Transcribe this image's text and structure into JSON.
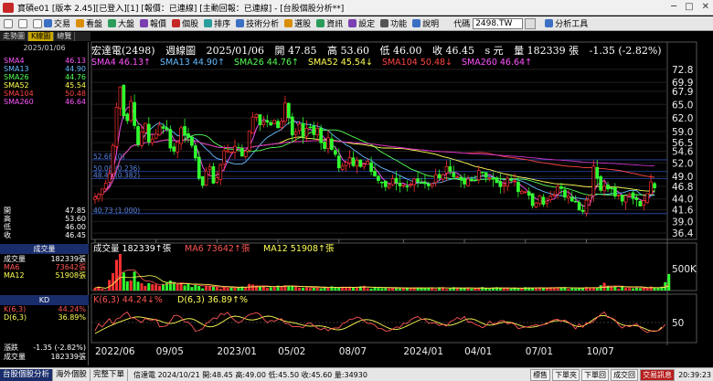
{
  "window": {
    "title": "寶碩e01 [版本 2.45][已登入][1] [報價：已連線] [主動回報：已連線] - [台股個股分析**]"
  },
  "toolbar": {
    "items": [
      "交易",
      "看盤",
      "大盤",
      "報價",
      "個股",
      "排序",
      "技術分析",
      "選股",
      "資訊",
      "設定",
      "功能",
      "說明"
    ],
    "code_label": "代碼",
    "code_value": "2498.TW",
    "analysis_tool": "分析工具"
  },
  "tabs": [
    "走勢圖",
    "K線圖",
    "總覽"
  ],
  "left_panel": {
    "date": "2025/01/06",
    "ma_rows": [
      {
        "k": "SMA4",
        "v": "46.13",
        "color": "#ff55ff"
      },
      {
        "k": "SMA13",
        "v": "44.90",
        "color": "#66bbff"
      },
      {
        "k": "SMA26",
        "v": "44.76",
        "color": "#55ff55"
      },
      {
        "k": "SMA52",
        "v": "45.54",
        "color": "#ffff55"
      },
      {
        "k": "SMA104",
        "v": "50.48",
        "color": "#ff4444"
      },
      {
        "k": "SMA260",
        "v": "46.64",
        "color": "#ff55ff"
      }
    ],
    "ohlc_rows": [
      {
        "k": "開",
        "v": "47.85"
      },
      {
        "k": "高",
        "v": "53.60"
      },
      {
        "k": "低",
        "v": "46.00"
      },
      {
        "k": "收",
        "v": "46.45"
      }
    ],
    "vol_head": "成交量",
    "vol_rows": [
      {
        "k": "成交量",
        "v": "182339張",
        "color": "#ffffff"
      },
      {
        "k": "MA6",
        "v": "73642張",
        "color": "#ff5555"
      },
      {
        "k": "MA12",
        "v": "51908張",
        "color": "#ffff55"
      }
    ],
    "kd_head": "KD",
    "kd_rows": [
      {
        "k": "K(6,3)",
        "v": "44.24%",
        "color": "#ff5555"
      },
      {
        "k": "D(6,3)",
        "v": "36.89%",
        "color": "#ffff55"
      }
    ],
    "change_rows": [
      {
        "k": "漲跌",
        "v": "-1.35 (-2.82%)"
      },
      {
        "k": "成交量",
        "v": "182339張"
      }
    ]
  },
  "chart_header": {
    "name": "宏達電(2498)",
    "period": "週線圖",
    "date": "2025/01/06",
    "open": "開 47.85",
    "high": "高 53.60",
    "low": "低 46.00",
    "close": "收 46.45",
    "unit": "s 元",
    "volume": "量 182339 張",
    "change": "-1.35 (-2.82%)"
  },
  "ma_legend": [
    {
      "text": "SMA4 46.13↑",
      "color": "#ff55ff"
    },
    {
      "text": "SMA13 44.90↑",
      "color": "#66bbff"
    },
    {
      "text": "SMA26 44.76↑",
      "color": "#55ff55"
    },
    {
      "text": "SMA52 45.54↓",
      "color": "#ffff55"
    },
    {
      "text": "SMA104 50.48↓",
      "color": "#ff4444"
    },
    {
      "text": "SMA260 46.64↑",
      "color": "#ff55ff"
    }
  ],
  "volume_legend": [
    {
      "text": "成交量 182339↑張",
      "color": "#ffffff"
    },
    {
      "text": "MA6 73642↑張",
      "color": "#ff5555"
    },
    {
      "text": "MA12 51908↑張",
      "color": "#ffff55"
    }
  ],
  "kd_legend": [
    {
      "text": "K(6,3) 44.24↓%",
      "color": "#ff5555"
    },
    {
      "text": "D(6,3) 36.89↑%",
      "color": "#ffff55"
    }
  ],
  "fib_labels": [
    "52.68 (0)",
    "50.08 (0.236)",
    "48.49 (0.382)",
    "40.73 (1.000)"
  ],
  "chart_data": {
    "type": "candlestick",
    "price_axis": [
      "72.8",
      "69.9",
      "67.9",
      "65.0",
      "62.0",
      "59.0",
      "56.5",
      "54.6",
      "52.0",
      "49.0",
      "46.8",
      "44.0",
      "41.6",
      "39.0",
      "36.4"
    ],
    "price_range": [
      35.0,
      74.0
    ],
    "x_labels": [
      "2022/06",
      "09/05",
      "2023/01",
      "05/02",
      "08/07",
      "2024/01",
      "04/01",
      "07/01",
      "10/07"
    ],
    "volume_axis": [
      "500K"
    ],
    "kd_axis": [
      "50"
    ],
    "fib_levels": [
      52.68,
      50.08,
      48.49,
      40.73
    ],
    "close_series": [
      44.4,
      45,
      46.2,
      47.5,
      49.6,
      55.9,
      64.4,
      68.9,
      62.5,
      61.4,
      65.7,
      60.3,
      56.1,
      58.9,
      60.8,
      56.7,
      57.3,
      58.4,
      60.4,
      59.7,
      59.5,
      55.3,
      54.6,
      56.6,
      59.8,
      58.2,
      57.7,
      55.9,
      53.1,
      48.6,
      47,
      50.2,
      51.1,
      47.5,
      48.7,
      51.6,
      54.7,
      54.7,
      54.4,
      55.7,
      55.4,
      53.5,
      54.6,
      59,
      62.2,
      62.8,
      60.5,
      61.1,
      61.1,
      60.4,
      61.5,
      59.8,
      61.2,
      65.3,
      62.1,
      58.2,
      58.9,
      60.6,
      57.9,
      59.7,
      59.8,
      58.3,
      59.7,
      56.5,
      55.2,
      57.6,
      55,
      53.9,
      50.9,
      51.3,
      52.1,
      53.2,
      51.4,
      52.6,
      51.2,
      51.7,
      52.4,
      50.1,
      49.1,
      48.1,
      47.7,
      46.7,
      47,
      48.5,
      47.6,
      46.9,
      47.1,
      46.7,
      47.3,
      48.4,
      47.8,
      47.6,
      47.4,
      46.9,
      47.4,
      49.4,
      48.7,
      49.4,
      51.2,
      50.1,
      48.9,
      48.9,
      48.3,
      47.3,
      48.4,
      48.2,
      48.2,
      50.3,
      49.9,
      48.8,
      48.7,
      48.4,
      47.6,
      46.7,
      47.2,
      48.6,
      48.1,
      48,
      45.6,
      45.7,
      45.6,
      44.8,
      42.5,
      43.1,
      44.7,
      42.8,
      43.5,
      44.6,
      44.9,
      46.8,
      46.3,
      44.4,
      44.6,
      43.5,
      43.3,
      41.5,
      41.2,
      43.7,
      44.8,
      51.3,
      48.6,
      45.9,
      46.8,
      46.2,
      46.4,
      44.6,
      44.9,
      43.5,
      44.6,
      45,
      44.1,
      43.8,
      42.4,
      43.6,
      45.2,
      47.8,
      46.45
    ],
    "volume_series": [
      29,
      44,
      20,
      7,
      116,
      192,
      338,
      402,
      199,
      101,
      110,
      208,
      97,
      80,
      51,
      80,
      69,
      68,
      52,
      72,
      85,
      109,
      88,
      71,
      79,
      56,
      75,
      39,
      67,
      51,
      24,
      53,
      49,
      43,
      39,
      20,
      36,
      29,
      42,
      35,
      31,
      44,
      30,
      72,
      66,
      54,
      44,
      41,
      29,
      36,
      44,
      54,
      45,
      58,
      54,
      53,
      42,
      32,
      31,
      36,
      28,
      33,
      36,
      23,
      35,
      32,
      46,
      40,
      30,
      41,
      34,
      36,
      31,
      41,
      47,
      52,
      25,
      21,
      40,
      32,
      26,
      28,
      20,
      26,
      26,
      29,
      34,
      34,
      26,
      33,
      29,
      29,
      24,
      35,
      32,
      15,
      36,
      37,
      15,
      21,
      37,
      33,
      26,
      28,
      34,
      20,
      22,
      25,
      38,
      26,
      18,
      33,
      37,
      27,
      30,
      30,
      20,
      27,
      20,
      25,
      37,
      34,
      27,
      34,
      33,
      23,
      29,
      37,
      34,
      36,
      32,
      31,
      18,
      27,
      23,
      32,
      33,
      38,
      31,
      36,
      26,
      58,
      86,
      53,
      39,
      43,
      21,
      48,
      29,
      27,
      23,
      38,
      25,
      28,
      26,
      44,
      33,
      34,
      42,
      92,
      182
    ],
    "k_series": [
      26.4,
      46.5,
      37,
      49.8,
      61.1,
      45.5,
      60.6,
      63.3,
      74.5,
      80.1,
      63.1,
      63.3,
      55.7,
      50.3,
      62,
      57.9,
      56.8,
      59.7,
      37.7,
      38.7,
      40.6,
      53.7,
      69.9,
      70.9,
      65.1,
      52.2,
      51.2,
      40.8,
      25.1,
      27.6,
      31.8,
      47.4,
      53.5,
      63.4,
      60.8,
      76,
      72.7,
      79.1,
      65.4,
      55.5,
      48.9,
      54.5,
      65.7,
      72.7,
      75.6,
      78.5,
      73.8,
      60.4,
      49.3,
      56.1,
      54,
      58.6,
      60.8,
      47.1,
      46.7,
      37.6,
      38.4,
      38.4,
      34.4,
      46.6,
      48.6,
      41.3,
      33.6,
      29.2,
      34.7,
      26.1,
      33.2,
      34.3,
      34.4,
      47,
      50.9,
      59.6,
      60,
      65.7,
      62.6,
      54.6,
      47.5,
      47.3,
      42.5,
      32.3,
      32.4,
      25.2,
      26.4,
      31.1,
      37.4,
      35.8,
      48,
      46.9,
      57.7,
      63.8,
      67.4,
      59.8,
      58.3,
      47.5,
      49,
      48.5,
      41.4,
      44.6,
      39.5,
      52.7,
      56.7,
      64.6,
      58.9,
      67.3,
      51.3,
      51.4,
      44.7,
      41.1,
      35,
      40.2,
      53.9,
      45.9,
      47.6,
      54.8,
      55.6,
      45.8,
      48.9,
      44.7,
      32.3,
      35,
      37.3,
      37.9,
      41.4,
      43.5,
      40.4,
      44.4,
      45.5,
      53.7,
      58.2,
      59.3,
      53.3,
      57.2,
      50.7,
      43.5,
      31.6,
      45.7,
      36.4,
      48.7,
      47.8,
      53.1,
      64.2,
      73.3,
      80.3,
      64.4,
      63.5,
      57.5,
      42.7,
      34.2,
      41.8,
      37.5,
      42,
      46.7,
      35.3,
      26.9,
      21.2,
      26.5,
      25.8,
      26,
      32.9,
      44.24
    ],
    "d_series": [
      18.5,
      23.8,
      29.2,
      34.5,
      39.6,
      44,
      48.3,
      52.1,
      56,
      59.8,
      63.1,
      65.6,
      66.3,
      65.3,
      63.4,
      61.3,
      59.8,
      58,
      55,
      51.2,
      48.2,
      47.1,
      48.2,
      51.8,
      56.3,
      59.7,
      61.2,
      60.5,
      56.8,
      50.8,
      44.5,
      39.4,
      37.5,
      38.6,
      42.6,
      48.5,
      55,
      61.6,
      66.5,
      68.5,
      67.5,
      64.3,
      60.6,
      57.9,
      57.3,
      59.1,
      62.5,
      66.2,
      68.3,
      67.9,
      65,
      60.8,
      57,
      53.8,
      51.6,
      50.1,
      48,
      45.2,
      42.7,
      40.3,
      39.4,
      39.9,
      40.3,
      40.1,
      38.4,
      35.4,
      32,
      29.5,
      29,
      30.9,
      34.7,
      39.9,
      45.6,
      50.9,
      55.2,
      57.8,
      58.5,
      56.9,
      53.4,
      48.7,
      43.2,
      37.9,
      33.3,
      30.4,
      29.9,
      31.9,
      35.6,
      40.2,
      45.1,
      50.2,
      55.2,
      59.1,
      60.9,
      59.9,
      56.8,
      52.6,
      48.4,
      44.9,
      42.5,
      42.2,
      44.3,
      48,
      52.7,
      57.4,
      60.3,
      60.4,
      57.6,
      53,
      47.8,
      43.9,
      42.3,
      43.1,
      45.7,
      48.7,
      50.9,
      51.3,
      50.1,
      47.4,
      43.8,
      40.1,
      37.4,
      36.3,
      36.7,
      38.5,
      41.3,
      44.3,
      47.8,
      51.3,
      54.1,
      55.5,
      55.2,
      53.1,
      49.3,
      44.3,
      39.9,
      38.2,
      39.9,
      44.8,
      51.7,
      59.3,
      65.9,
      69.5,
      69.7,
      67.1,
      62.1,
      55.2,
      48.4,
      43.5,
      41.4,
      41.2,
      41.6,
      40.7,
      37.9,
      33.7,
      29.3,
      25.9,
      24.6,
      26.2,
      36.89
    ]
  }
}
